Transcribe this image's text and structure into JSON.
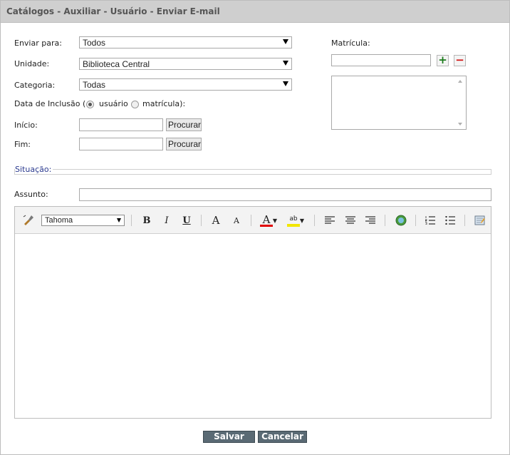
{
  "window": {
    "title": "Catálogos - Auxiliar - Usuário - Enviar E-mail"
  },
  "form": {
    "enviar_para": {
      "label": "Enviar para:",
      "value": "Todos"
    },
    "unidade": {
      "label": "Unidade:",
      "value": "Biblioteca Central"
    },
    "categoria": {
      "label": "Categoria:",
      "value": "Todas"
    },
    "data_inclusao": {
      "label": "Data de Inclusão (",
      "opt1": "usuário",
      "opt2": "matrícula):",
      "selected": "usuário"
    },
    "inicio": {
      "label": "Início:",
      "button": "Procurar",
      "value": ""
    },
    "fim": {
      "label": "Fim:",
      "button": "Procurar",
      "value": ""
    },
    "matricula": {
      "label": "Matrícula:",
      "add": "+",
      "remove": "−",
      "value": ""
    },
    "situacao": {
      "legend": "Situação:"
    },
    "assunto": {
      "label": "Assunto:",
      "value": ""
    }
  },
  "editor": {
    "font_family": "Tahoma",
    "tools": [
      "paint-brush-icon",
      "bold-icon",
      "italic-icon",
      "underline-icon",
      "font-size-up-icon",
      "font-size-down-icon",
      "font-color-icon",
      "highlight-color-icon",
      "align-left-icon",
      "align-center-icon",
      "align-right-icon",
      "insert-link-icon",
      "ordered-list-icon",
      "unordered-list-icon",
      "html-mode-icon"
    ],
    "labels": {
      "bold": "B",
      "italic": "I",
      "underline": "U",
      "size_up": "A",
      "size_down": "A",
      "font_color": "A",
      "highlight": "ab"
    },
    "colors": {
      "font_color": "#e00000",
      "highlight": "#f2e600"
    }
  },
  "actions": {
    "save": "Salvar",
    "cancel": "Cancelar"
  }
}
